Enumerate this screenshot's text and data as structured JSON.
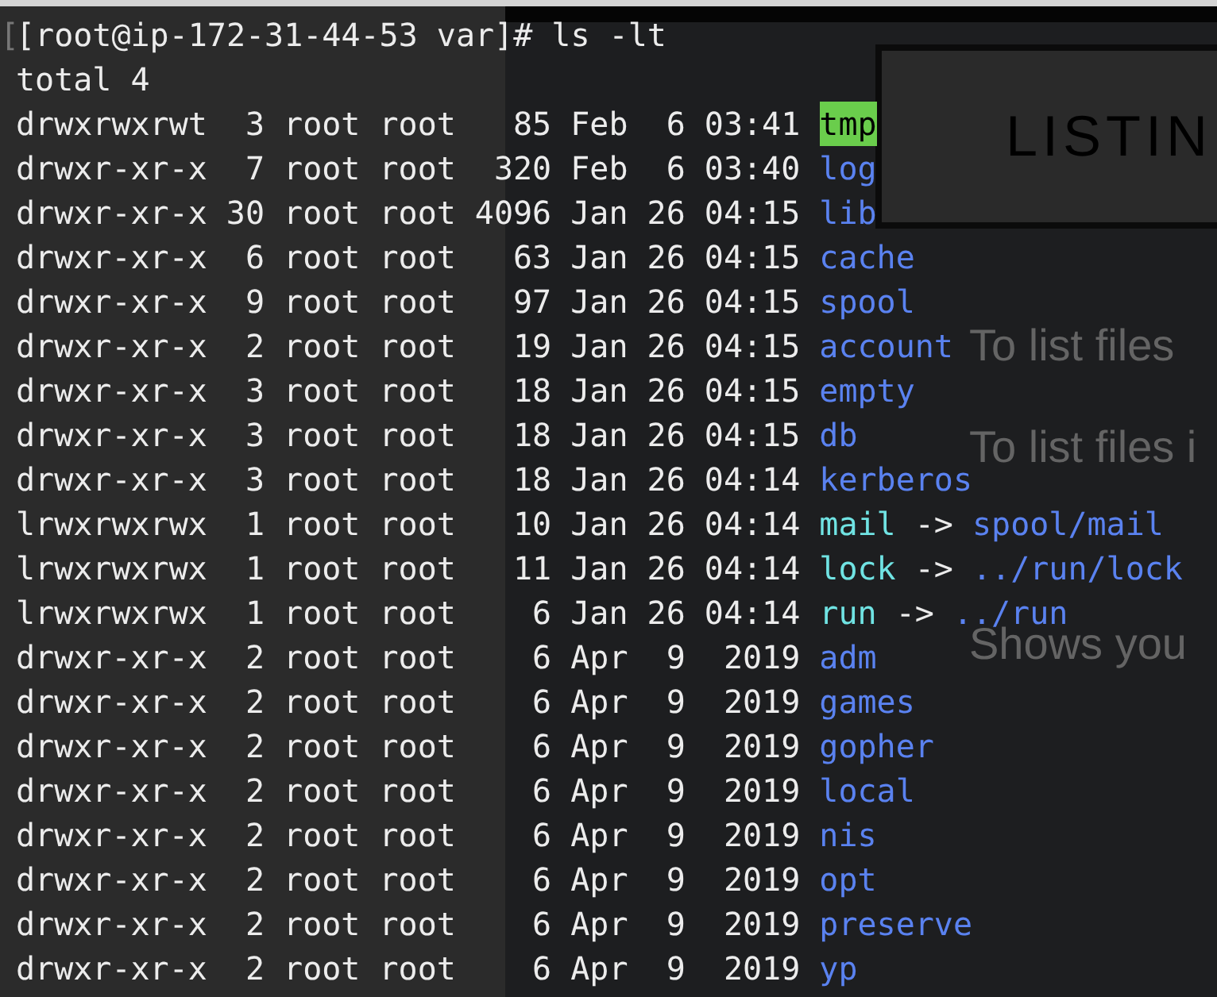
{
  "background_slide": {
    "title": "LISTIN",
    "lines": [
      "To list files",
      "To list files i",
      "Shows you"
    ]
  },
  "terminal": {
    "mark_glyph": "[",
    "prompt": "[root@ip-172-31-44-53 var]# ls -lt",
    "total": "total 4",
    "entries": [
      {
        "kind": "sticky",
        "perms": "drwxrwxrwt",
        "links": "3",
        "owner": "root",
        "group": "root",
        "size": "85",
        "date": "Feb  6 03:41",
        "name": "tmp"
      },
      {
        "kind": "dir",
        "perms": "drwxr-xr-x",
        "links": "7",
        "owner": "root",
        "group": "root",
        "size": "320",
        "date": "Feb  6 03:40",
        "name": "log"
      },
      {
        "kind": "dir",
        "perms": "drwxr-xr-x",
        "links": "30",
        "owner": "root",
        "group": "root",
        "size": "4096",
        "date": "Jan 26 04:15",
        "name": "lib"
      },
      {
        "kind": "dir",
        "perms": "drwxr-xr-x",
        "links": "6",
        "owner": "root",
        "group": "root",
        "size": "63",
        "date": "Jan 26 04:15",
        "name": "cache"
      },
      {
        "kind": "dir",
        "perms": "drwxr-xr-x",
        "links": "9",
        "owner": "root",
        "group": "root",
        "size": "97",
        "date": "Jan 26 04:15",
        "name": "spool"
      },
      {
        "kind": "dir",
        "perms": "drwxr-xr-x",
        "links": "2",
        "owner": "root",
        "group": "root",
        "size": "19",
        "date": "Jan 26 04:15",
        "name": "account"
      },
      {
        "kind": "dir",
        "perms": "drwxr-xr-x",
        "links": "3",
        "owner": "root",
        "group": "root",
        "size": "18",
        "date": "Jan 26 04:15",
        "name": "empty"
      },
      {
        "kind": "dir",
        "perms": "drwxr-xr-x",
        "links": "3",
        "owner": "root",
        "group": "root",
        "size": "18",
        "date": "Jan 26 04:15",
        "name": "db"
      },
      {
        "kind": "dir",
        "perms": "drwxr-xr-x",
        "links": "3",
        "owner": "root",
        "group": "root",
        "size": "18",
        "date": "Jan 26 04:14",
        "name": "kerberos"
      },
      {
        "kind": "symlink",
        "perms": "lrwxrwxrwx",
        "links": "1",
        "owner": "root",
        "group": "root",
        "size": "10",
        "date": "Jan 26 04:14",
        "name": "mail",
        "arrow": "->",
        "target": "spool/mail"
      },
      {
        "kind": "symlink",
        "perms": "lrwxrwxrwx",
        "links": "1",
        "owner": "root",
        "group": "root",
        "size": "11",
        "date": "Jan 26 04:14",
        "name": "lock",
        "arrow": "->",
        "target": "../run/lock"
      },
      {
        "kind": "symlink",
        "perms": "lrwxrwxrwx",
        "links": "1",
        "owner": "root",
        "group": "root",
        "size": "6",
        "date": "Jan 26 04:14",
        "name": "run",
        "arrow": "->",
        "target": "../run"
      },
      {
        "kind": "dir",
        "perms": "drwxr-xr-x",
        "links": "2",
        "owner": "root",
        "group": "root",
        "size": "6",
        "date": "Apr  9  2019",
        "name": "adm"
      },
      {
        "kind": "dir",
        "perms": "drwxr-xr-x",
        "links": "2",
        "owner": "root",
        "group": "root",
        "size": "6",
        "date": "Apr  9  2019",
        "name": "games"
      },
      {
        "kind": "dir",
        "perms": "drwxr-xr-x",
        "links": "2",
        "owner": "root",
        "group": "root",
        "size": "6",
        "date": "Apr  9  2019",
        "name": "gopher"
      },
      {
        "kind": "dir",
        "perms": "drwxr-xr-x",
        "links": "2",
        "owner": "root",
        "group": "root",
        "size": "6",
        "date": "Apr  9  2019",
        "name": "local"
      },
      {
        "kind": "dir",
        "perms": "drwxr-xr-x",
        "links": "2",
        "owner": "root",
        "group": "root",
        "size": "6",
        "date": "Apr  9  2019",
        "name": "nis"
      },
      {
        "kind": "dir",
        "perms": "drwxr-xr-x",
        "links": "2",
        "owner": "root",
        "group": "root",
        "size": "6",
        "date": "Apr  9  2019",
        "name": "opt"
      },
      {
        "kind": "dir",
        "perms": "drwxr-xr-x",
        "links": "2",
        "owner": "root",
        "group": "root",
        "size": "6",
        "date": "Apr  9  2019",
        "name": "preserve"
      },
      {
        "kind": "dir",
        "perms": "drwxr-xr-x",
        "links": "2",
        "owner": "root",
        "group": "root",
        "size": "6",
        "date": "Apr  9  2019",
        "name": "yp"
      }
    ]
  }
}
